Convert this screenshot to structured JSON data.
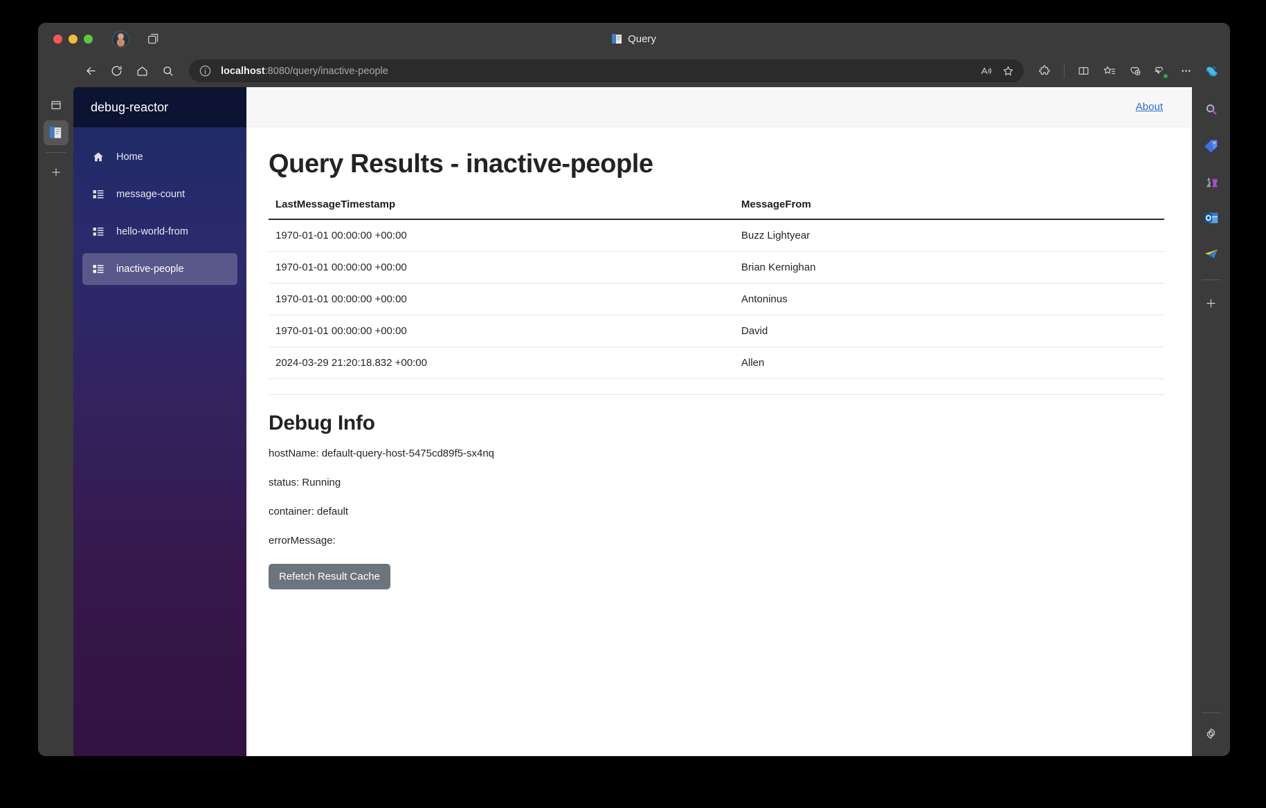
{
  "window": {
    "title": "Query",
    "title_icon": "document-icon",
    "traffic_lights": [
      "close",
      "minimize",
      "maximize"
    ]
  },
  "toolbar": {
    "back": "back-arrow-icon",
    "reload": "reload-icon",
    "home": "home-icon",
    "search": "search-icon",
    "site_info": "info-icon",
    "url_host": "localhost",
    "url_path": ":8080/query/inactive-people",
    "read_aloud": "read-aloud-icon",
    "favorite": "star-icon",
    "extensions": "puzzle-icon",
    "split_screen": "split-screen-icon",
    "collections_add": "star-list-icon",
    "add_collection": "add-collection-icon",
    "browser_essentials": "browser-essentials-icon",
    "more": "ellipsis-icon",
    "copilot": "copilot-icon"
  },
  "tab_rail": {
    "tab_groups": "tab-groups-icon",
    "active_tab": "query-tab",
    "new_tab": "plus-icon"
  },
  "sidebar": {
    "brand": "debug-reactor",
    "items": [
      {
        "label": "Home",
        "icon": "home-icon",
        "active": false
      },
      {
        "label": "message-count",
        "icon": "list-icon",
        "active": false
      },
      {
        "label": "hello-world-from",
        "icon": "list-icon",
        "active": false
      },
      {
        "label": "inactive-people",
        "icon": "list-icon",
        "active": true
      }
    ]
  },
  "header": {
    "about_label": "About"
  },
  "main": {
    "page_title": "Query Results - inactive-people",
    "table": {
      "columns": [
        "LastMessageTimestamp",
        "MessageFrom"
      ],
      "rows": [
        [
          "1970-01-01 00:00:00 +00:00",
          "Buzz Lightyear"
        ],
        [
          "1970-01-01 00:00:00 +00:00",
          "Brian Kernighan"
        ],
        [
          "1970-01-01 00:00:00 +00:00",
          "Antoninus"
        ],
        [
          "1970-01-01 00:00:00 +00:00",
          "David"
        ],
        [
          "2024-03-29 21:20:18.832 +00:00",
          "Allen"
        ]
      ]
    },
    "debug": {
      "title": "Debug Info",
      "host_name": "hostName: default-query-host-5475cd89f5-sx4nq",
      "status": "status: Running",
      "container": "container: default",
      "error_message": "errorMessage:",
      "refetch_label": "Refetch Result Cache"
    }
  },
  "edge_sidebar": {
    "items": [
      "discover-icon",
      "shopping-tag-icon",
      "games-icon",
      "outlook-icon",
      "telegram-icon"
    ],
    "add": "plus-icon",
    "settings": "gear-icon"
  },
  "colors": {
    "chrome": "#3b3b3b",
    "sidebar_top": "#1b2a63",
    "sidebar_bottom": "#341243",
    "link": "#2c6bd4",
    "button": "#6c757d"
  }
}
